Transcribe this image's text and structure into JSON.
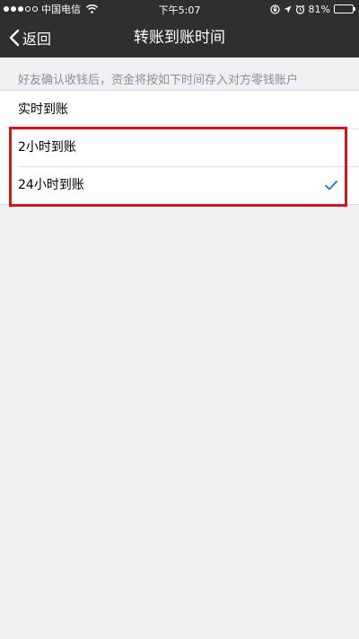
{
  "status_bar": {
    "carrier": "中国电信",
    "time": "下午5:07",
    "battery_percent": "81%",
    "battery_level": 0.81
  },
  "nav": {
    "back_label": "返回",
    "title": "转账到账时间"
  },
  "hint": "好友确认收钱后，资金将按如下时间存入对方零钱账户",
  "options": [
    {
      "label": "实时到账",
      "selected": false
    },
    {
      "label": "2小时到账",
      "selected": false
    },
    {
      "label": "24小时到账",
      "selected": true
    }
  ],
  "colors": {
    "nav_background": "#2f2f33",
    "page_background": "#efeff4",
    "checkmark": "#1a75c4",
    "highlight_border": "#d7141b"
  },
  "icons": {
    "back": "chevron-left-icon",
    "checkmark": "checkmark-icon",
    "wifi": "wifi-icon",
    "location": "location-arrow-icon",
    "alarm": "alarm-clock-icon",
    "rotation_lock": "rotation-lock-icon"
  }
}
